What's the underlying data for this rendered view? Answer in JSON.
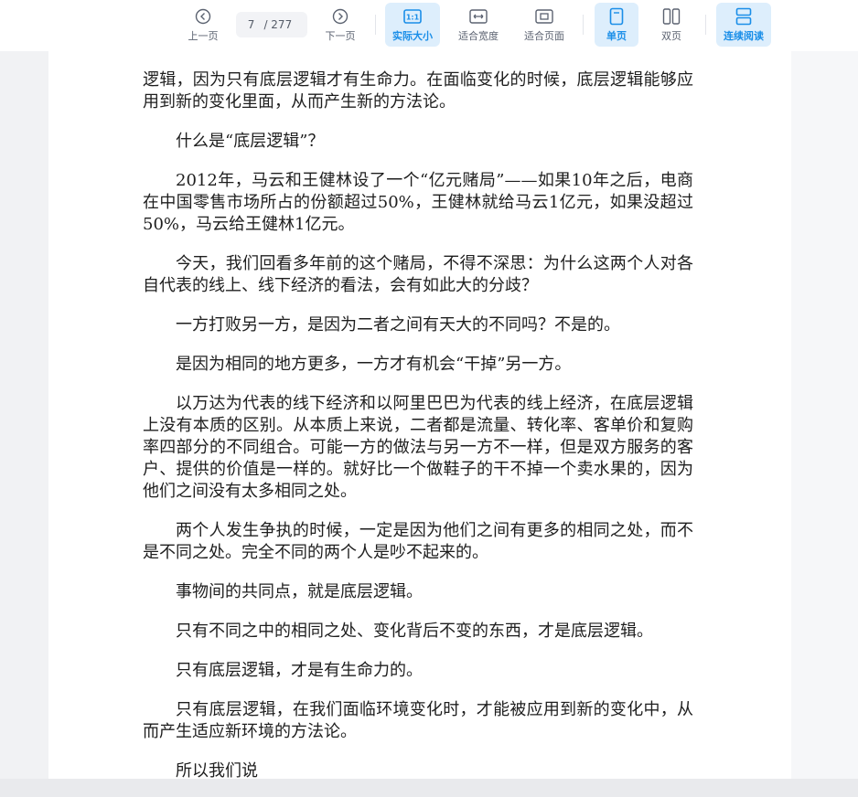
{
  "toolbar": {
    "prev_label": "上一页",
    "page_current": "7",
    "page_total": "/ 277",
    "next_label": "下一页",
    "actual_size_label": "实际大小",
    "fit_width_label": "适合宽度",
    "fit_page_label": "适合页面",
    "single_page_label": "单页",
    "double_page_label": "双页",
    "continuous_label": "连续阅读",
    "accent_color": "#1a8ee8",
    "icons": [
      "chevron-left-icon",
      "chevron-right-icon",
      "actual-size-icon",
      "fit-width-icon",
      "fit-page-icon",
      "single-page-icon",
      "double-page-icon",
      "continuous-read-icon"
    ]
  },
  "document": {
    "paragraphs": [
      "逻辑，因为只有底层逻辑才有生命力。在面临变化的时候，底层逻辑能够应用到新的变化里面，从而产生新的方法论。",
      "什么是“底层逻辑”？",
      "2012年，马云和王健林设了一个“亿元赌局”——如果10年之后，电商在中国零售市场所占的份额超过50%，王健林就给马云1亿元，如果没超过50%，马云给王健林1亿元。",
      "今天，我们回看多年前的这个赌局，不得不深思：为什么这两个人对各自代表的线上、线下经济的看法，会有如此大的分歧？",
      "一方打败另一方，是因为二者之间有天大的不同吗？不是的。",
      "是因为相同的地方更多，一方才有机会“干掉”另一方。",
      "以万达为代表的线下经济和以阿里巴巴为代表的线上经济，在底层逻辑上没有本质的区别。从本质上来说，二者都是流量、转化率、客单价和复购率四部分的不同组合。可能一方的做法与另一方不一样，但是双方服务的客户、提供的价值是一样的。就好比一个做鞋子的干不掉一个卖水果的，因为他们之间没有太多相同之处。",
      "两个人发生争执的时候，一定是因为他们之间有更多的相同之处，而不是不同之处。完全不同的两个人是吵不起来的。",
      "事物间的共同点，就是底层逻辑。",
      "只有不同之中的相同之处、变化背后不变的东西，才是底层逻辑。",
      "只有底层逻辑，才是有生命力的。",
      "只有底层逻辑，在我们面临环境变化时，才能被应用到新的变化中，从而产生适应新环境的方法论。",
      "所以我们说"
    ]
  }
}
